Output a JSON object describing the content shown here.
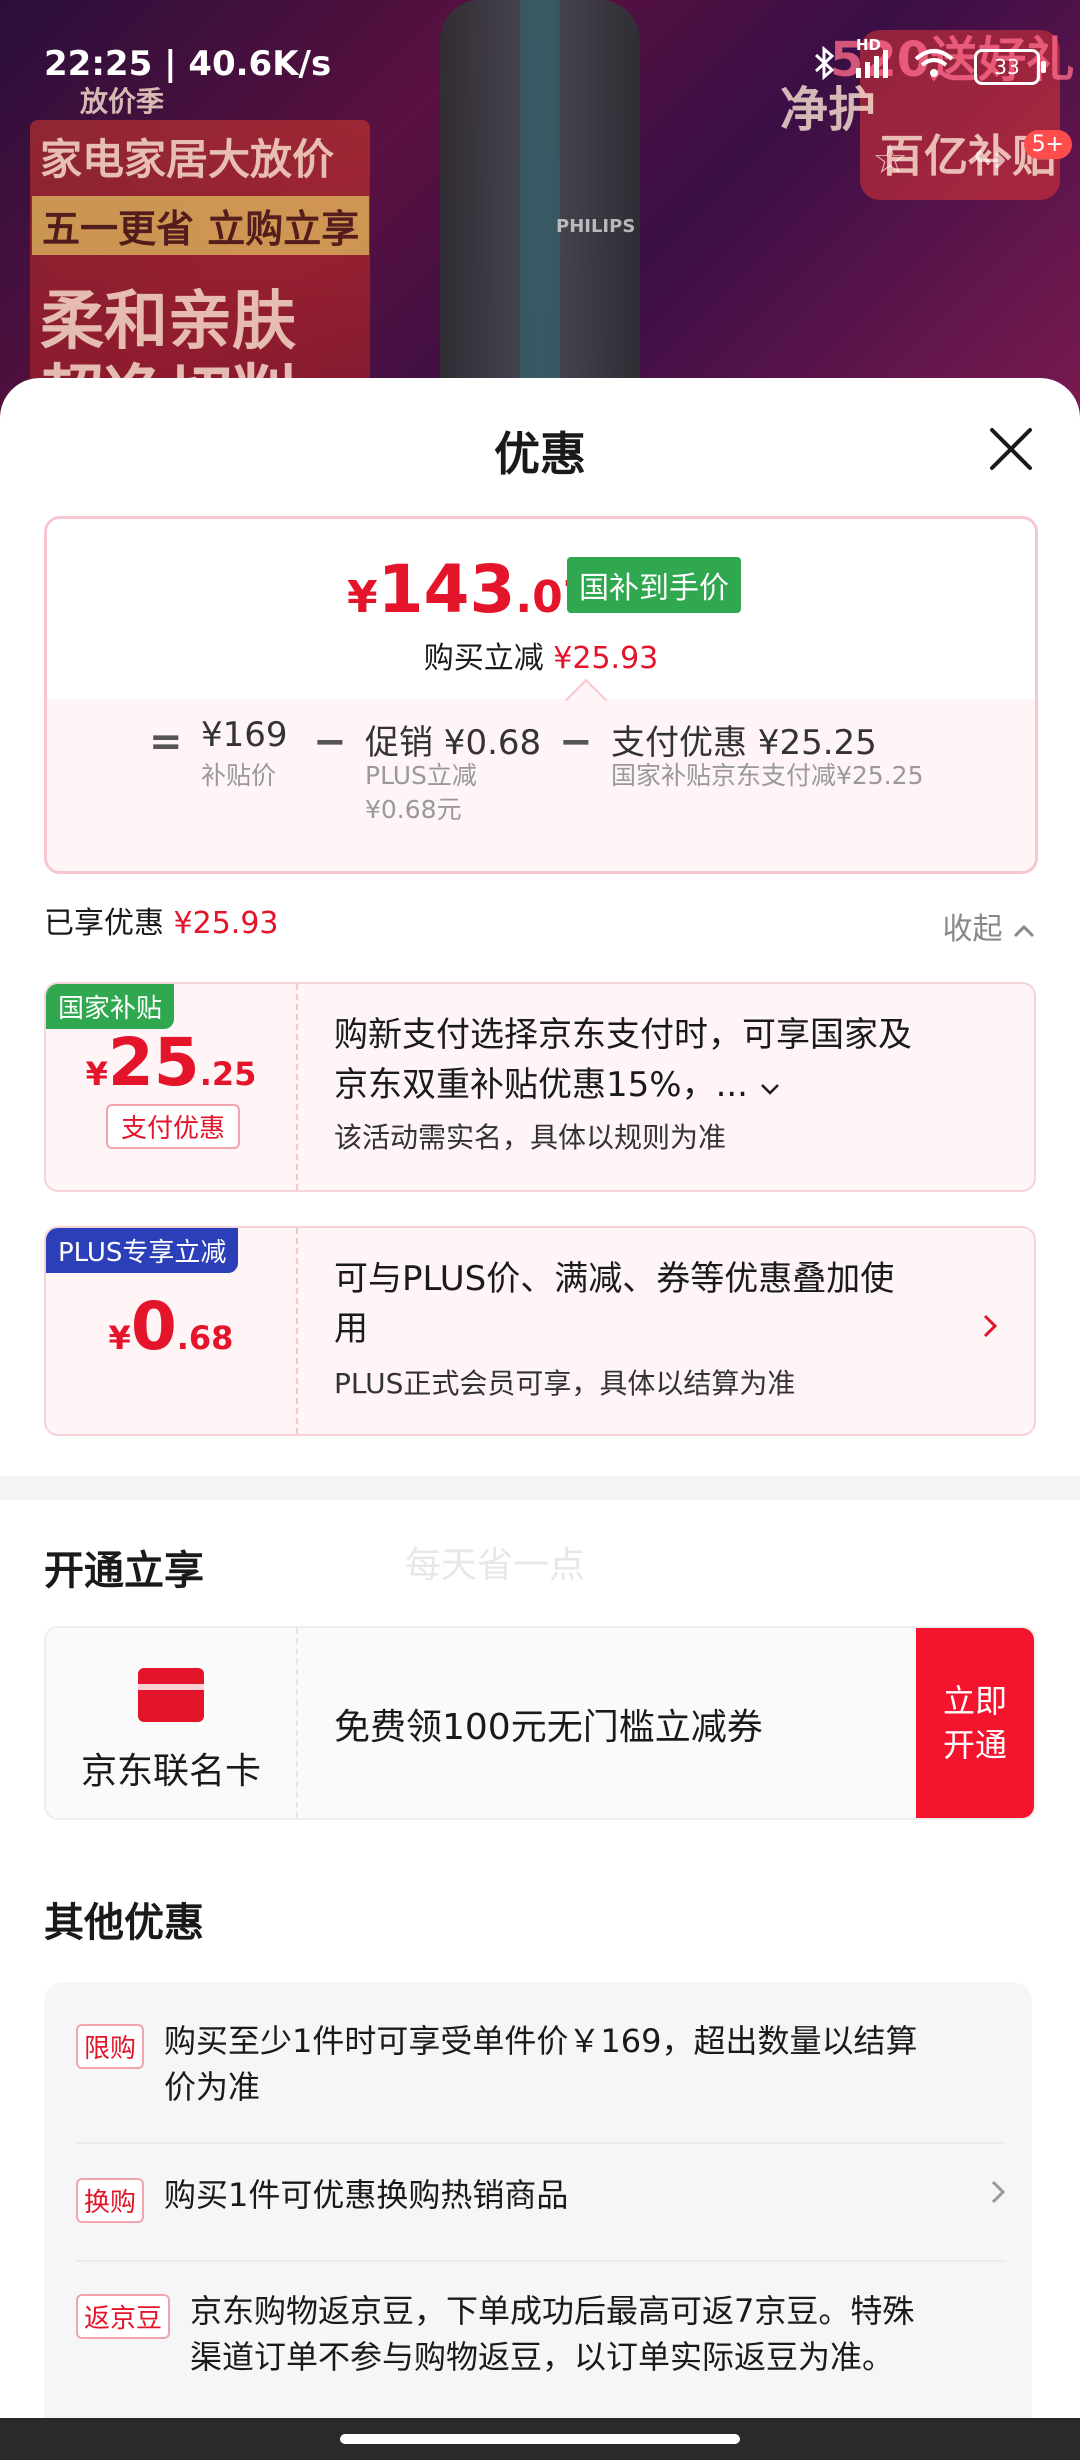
{
  "status_bar": {
    "time_speed": "22:25 | 40.6K/s",
    "battery": "33",
    "network_label": "HD"
  },
  "background": {
    "brand_tag": "放价季",
    "headline1": "家电家居大放价",
    "headline2": "五一更省 立购立享",
    "headline3": "柔和亲肤",
    "headline4": "超净切削",
    "product_brand": "PHILIPS",
    "right_text1": "520送好礼",
    "right_text2": "净护",
    "right_text3": "百亿补贴",
    "badge": "5+"
  },
  "sheet": {
    "title": "优惠"
  },
  "price_card": {
    "yen": "¥",
    "price_int": "143",
    "price_dec": ".07",
    "tag": "国补到手价",
    "reduce_label": "购买立减",
    "reduce_amount": "¥25.93",
    "eq": "=",
    "base_value": "¥169",
    "base_label": "补贴价",
    "minus1": "−",
    "promo_value": "促销 ¥0.68",
    "promo_sub1": "PLUS立减",
    "promo_sub2": "¥0.68元",
    "minus2": "−",
    "pay_value": "支付优惠 ¥25.25",
    "pay_sub": "国家补贴京东支付减¥25.25"
  },
  "enjoyed": {
    "label": "已享优惠",
    "amount": "¥25.93",
    "collapse": "收起"
  },
  "coupons": [
    {
      "tag": "国家补贴",
      "yen": "¥",
      "int": "25",
      "dec": ".25",
      "btn": "支付优惠",
      "line1": "购新支付选择京东支付时，可享国家及",
      "line2": "京东双重补贴优惠15%，...",
      "note": "该活动需实名，具体以规则为准"
    },
    {
      "tag": "PLUS专享立减",
      "yen": "¥",
      "int": "0",
      "dec": ".68",
      "line1": "可与PLUS价、满减、券等优惠叠加使",
      "line2": "用",
      "note": "PLUS正式会员可享，具体以结算为准"
    }
  ],
  "watermark": "每天省一点",
  "open_section": {
    "title": "开通立享",
    "card_name": "京东联名卡",
    "desc": "免费领100元无门槛立减券",
    "btn_line1": "立即",
    "btn_line2": "开通"
  },
  "other_section": {
    "title": "其他优惠",
    "items": [
      {
        "label": "限购",
        "line1": "购买至少1件时可享受单件价￥169，超出数量以结算",
        "line2": "价为准"
      },
      {
        "label": "换购",
        "line1": "购买1件可优惠换购热销商品"
      },
      {
        "label": "返京豆",
        "line1": "京东购物返京豆，下单成功后最高可返7京豆。特殊",
        "line2": "渠道订单不参与购物返豆，以订单实际返豆为准。"
      }
    ]
  },
  "colors": {
    "accent_red": "#e4142b",
    "gov_green": "#2fa84f",
    "plus_blue": "#2a3fb8"
  }
}
